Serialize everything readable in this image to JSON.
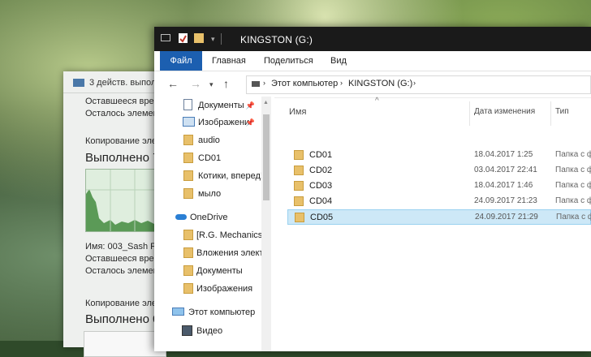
{
  "copy_dialog": {
    "header": "3 действ. выпол",
    "line1": "Оставшееся врем",
    "line2": "Осталось элемен",
    "section1": "Копирование эле",
    "done1": "Выполнено 7",
    "name_line": "Имя: 003_Sash Fe",
    "line3": "Оставшееся врем",
    "line4": "Осталось элемен",
    "section2": "Копирование эле",
    "done2": "Выполнено 0"
  },
  "explorer": {
    "title": "KINGSTON (G:)",
    "ribbon_tabs": [
      "Файл",
      "Главная",
      "Поделиться",
      "Вид"
    ],
    "breadcrumb": [
      "Этот компьютер",
      "KINGSTON (G:)"
    ],
    "nav_items": [
      {
        "label": "Документы",
        "icon": "document-icon",
        "pinned": true
      },
      {
        "label": "Изображени",
        "icon": "pictures-icon",
        "pinned": true
      },
      {
        "label": "audio",
        "icon": "folder-icon"
      },
      {
        "label": "CD01",
        "icon": "folder-icon"
      },
      {
        "label": "Котики, вперед!",
        "icon": "folder-icon"
      },
      {
        "label": "мыло",
        "icon": "folder-icon"
      },
      {
        "label": "OneDrive",
        "icon": "cloud-icon"
      },
      {
        "label": "[R.G. Mechanics",
        "icon": "folder-icon"
      },
      {
        "label": "Вложения элект",
        "icon": "folder-icon"
      },
      {
        "label": "Документы",
        "icon": "folder-icon"
      },
      {
        "label": "Изображения",
        "icon": "folder-icon"
      },
      {
        "label": "Этот компьютер",
        "icon": "computer-icon"
      },
      {
        "label": "Видео",
        "icon": "video-icon"
      }
    ],
    "columns": [
      "Имя",
      "Дата изменения",
      "Тип"
    ],
    "files": [
      {
        "name": "CD01",
        "date": "18.04.2017 1:25",
        "type": "Папка с ф"
      },
      {
        "name": "CD02",
        "date": "03.04.2017 22:41",
        "type": "Папка с ф"
      },
      {
        "name": "CD03",
        "date": "18.04.2017 1:46",
        "type": "Папка с ф"
      },
      {
        "name": "CD04",
        "date": "24.09.2017 21:23",
        "type": "Папка с ф"
      },
      {
        "name": "CD05",
        "date": "24.09.2017 21:29",
        "type": "Папка с ф"
      }
    ],
    "selected_file": "CD05"
  },
  "colors": {
    "titlebar": "#1a1a1a",
    "file_tab": "#1c5fb0",
    "selection": "#cde8f7",
    "folder": "#e8c06a"
  }
}
